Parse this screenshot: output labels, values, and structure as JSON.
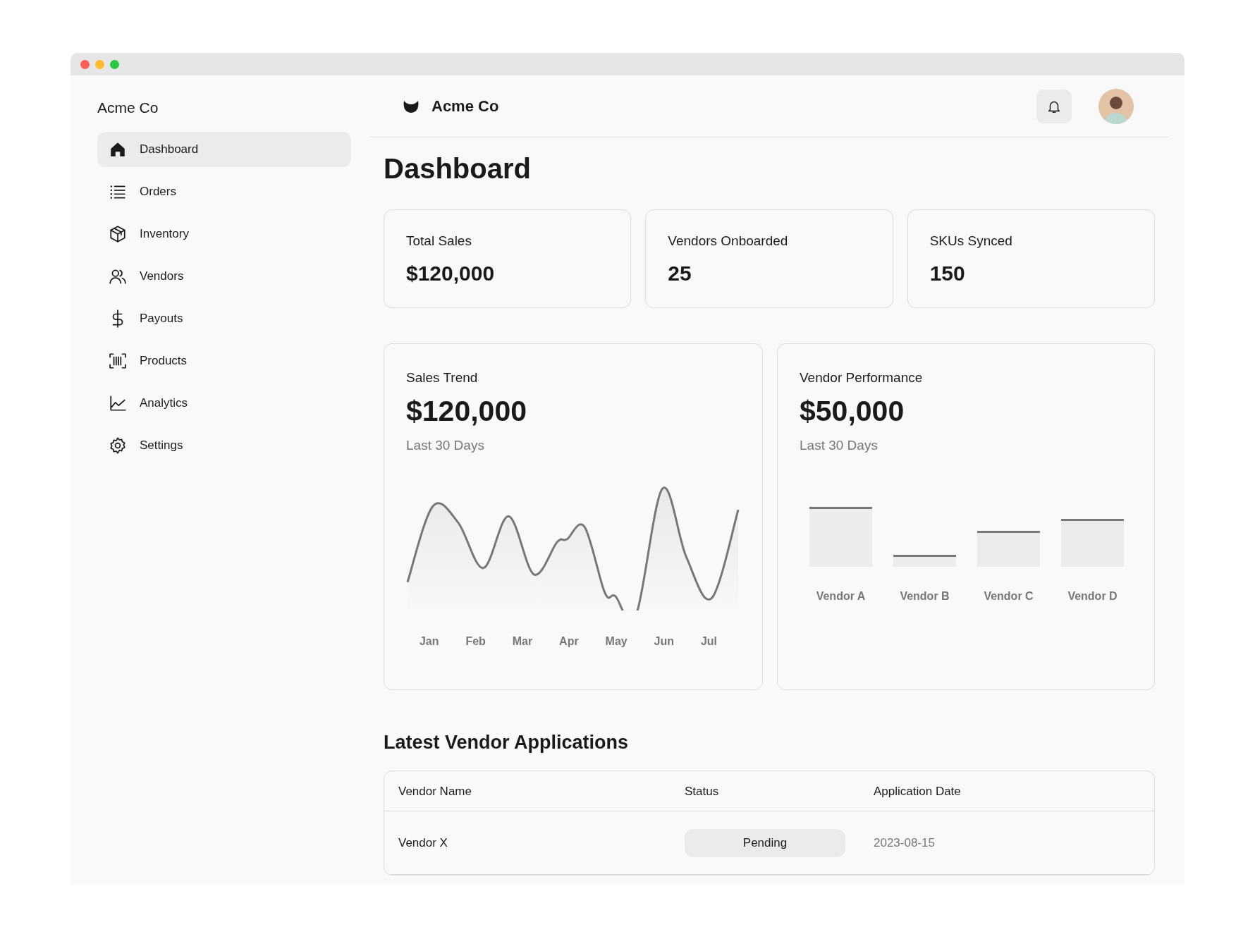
{
  "sidebar": {
    "title": "Acme Co",
    "items": [
      {
        "label": "Dashboard",
        "selected": true
      },
      {
        "label": "Orders",
        "selected": false
      },
      {
        "label": "Inventory",
        "selected": false
      },
      {
        "label": "Vendors",
        "selected": false
      },
      {
        "label": "Payouts",
        "selected": false
      },
      {
        "label": "Products",
        "selected": false
      },
      {
        "label": "Analytics",
        "selected": false
      },
      {
        "label": "Settings",
        "selected": false
      }
    ]
  },
  "header": {
    "brand": "Acme Co"
  },
  "page_title": "Dashboard",
  "stats": [
    {
      "label": "Total Sales",
      "value": "$120,000"
    },
    {
      "label": "Vendors Onboarded",
      "value": "25"
    },
    {
      "label": "SKUs Synced",
      "value": "150"
    }
  ],
  "charts": [
    {
      "kind": "line",
      "title": "Sales Trend",
      "value": "$120,000",
      "period": "Last 30 Days",
      "labels": [
        "Jan",
        "Feb",
        "Mar",
        "Apr",
        "May",
        "Jun",
        "Jul"
      ]
    },
    {
      "kind": "bar",
      "title": "Vendor Performance",
      "value": "$50,000",
      "period": "Last 30 Days",
      "labels": [
        "Vendor A",
        "Vendor B",
        "Vendor C",
        "Vendor D"
      ]
    }
  ],
  "applications": {
    "title": "Latest Vendor Applications",
    "columns": [
      "Vendor Name",
      "Status",
      "Application Date"
    ],
    "rows": [
      {
        "vendor_name": "Vendor X",
        "status": "Pending",
        "application_date": "2023-08-15"
      }
    ]
  }
}
